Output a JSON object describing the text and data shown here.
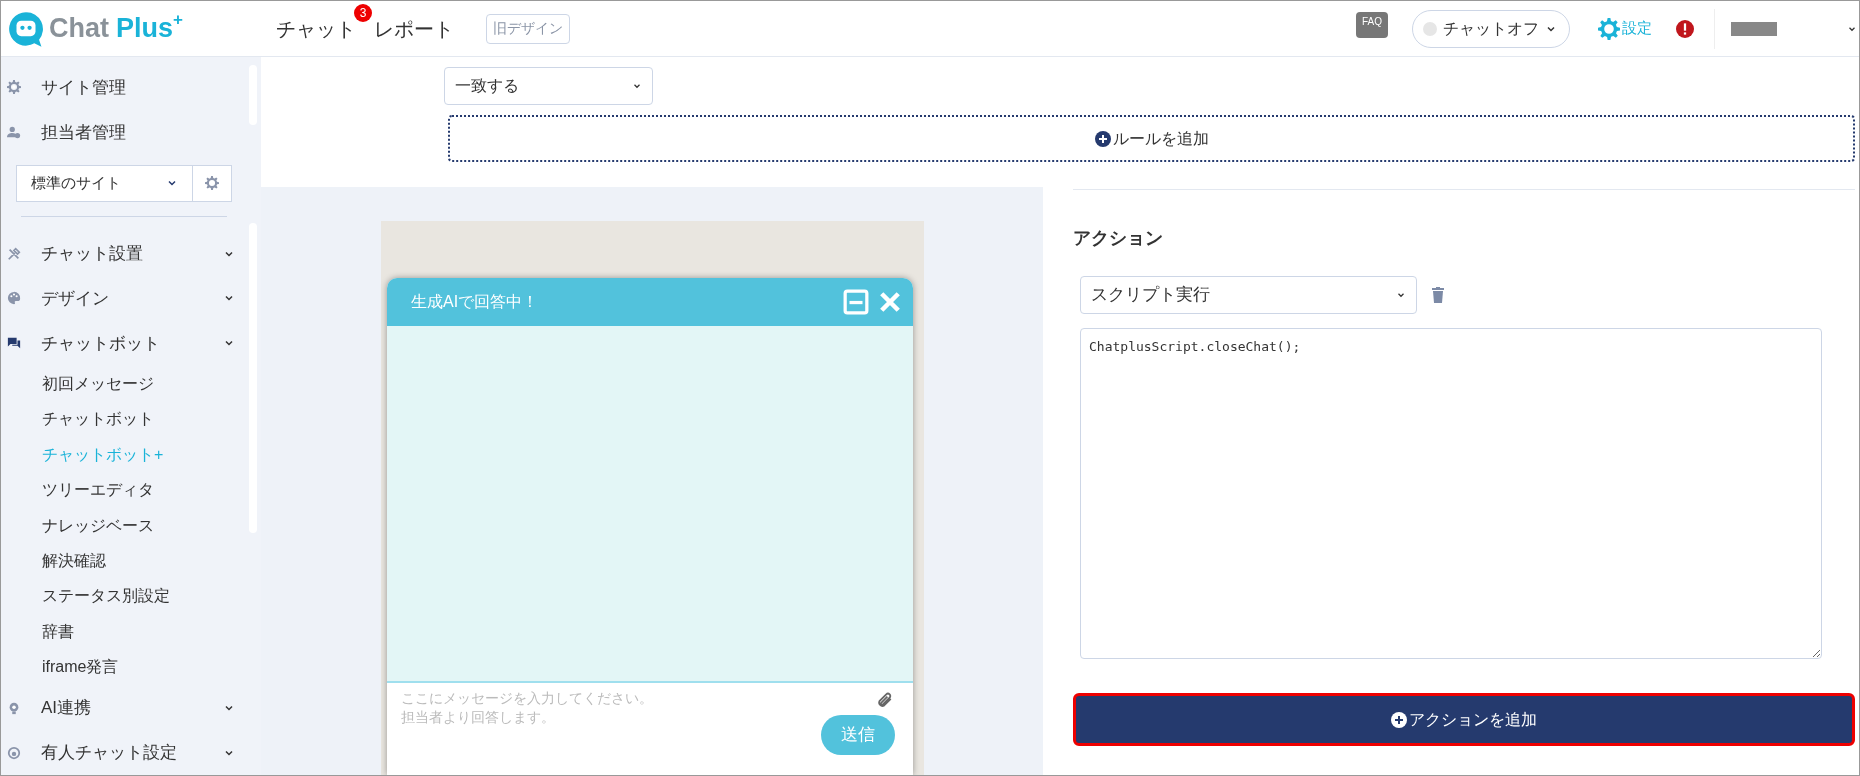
{
  "header": {
    "logo": {
      "first": "Chat",
      "second": "Plus",
      "mark": "+"
    },
    "nav": [
      {
        "label": "チャット",
        "badge": "3"
      },
      {
        "label": "レポート"
      }
    ],
    "old_design_button": "旧デザイン",
    "faq_label": "FAQ",
    "chat_status": {
      "label": "チャットオフ",
      "on": false
    },
    "settings_label": "設定"
  },
  "sidebar": {
    "top_items": [
      {
        "label": "サイト管理"
      },
      {
        "label": "担当者管理"
      }
    ],
    "site_select": "標準のサイト",
    "menu": [
      {
        "label": "チャット設置"
      },
      {
        "label": "デザイン"
      },
      {
        "label": "チャットボット",
        "children": [
          {
            "label": "初回メッセージ",
            "selected": false
          },
          {
            "label": "チャットボット",
            "selected": false
          },
          {
            "label": "チャットボット+",
            "selected": true
          },
          {
            "label": "ツリーエディタ",
            "selected": false
          },
          {
            "label": "ナレッジベース",
            "selected": false
          },
          {
            "label": "解決確認",
            "selected": false
          },
          {
            "label": "ステータス別設定",
            "selected": false
          },
          {
            "label": "辞書",
            "selected": false
          },
          {
            "label": "iframe発言",
            "selected": false
          }
        ]
      },
      {
        "label": "AI連携"
      },
      {
        "label": "有人チャット設定"
      }
    ]
  },
  "rules": {
    "match_select": "一致する",
    "add_rule_button": "ルールを追加"
  },
  "preview": {
    "title": "生成AIで回答中！",
    "placeholder": "ここにメッセージを入力してください。担当者より回答します。",
    "send_button": "送信"
  },
  "actions": {
    "heading": "アクション",
    "action_select": "スクリプト実行",
    "script": "ChatplusScript.closeChat();",
    "add_action_button": "アクションを追加"
  }
}
